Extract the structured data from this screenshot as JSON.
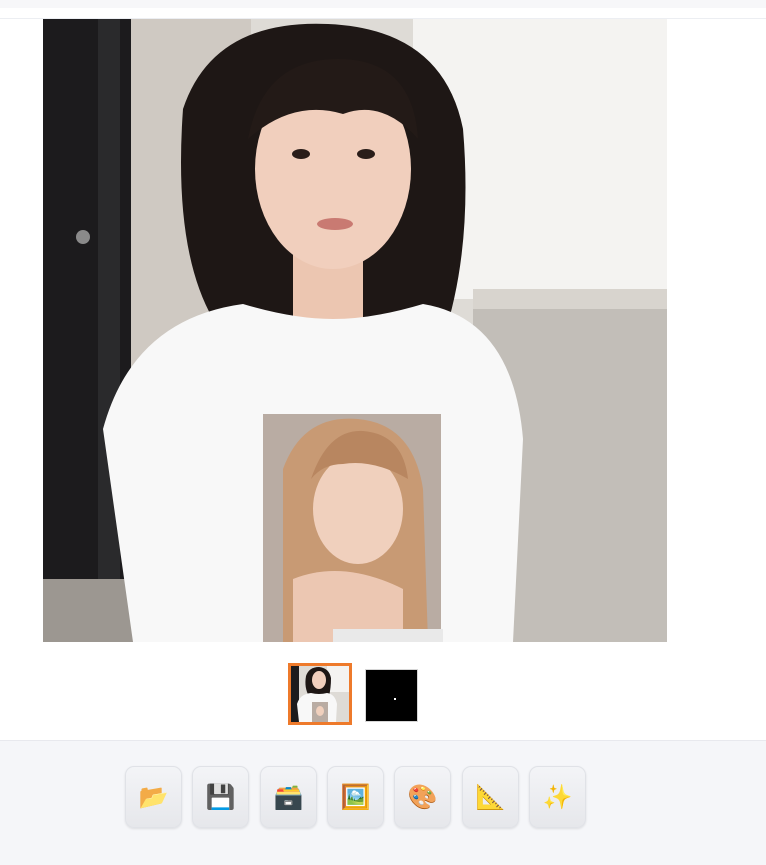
{
  "gallery": {
    "thumbnails": [
      {
        "name": "generated-image-thumb",
        "selected": true
      },
      {
        "name": "mask-image-thumb",
        "selected": false
      }
    ],
    "selected_border_color": "#ee7a2b"
  },
  "toolbar": {
    "buttons": [
      {
        "name": "open-folder-button",
        "icon": "📂"
      },
      {
        "name": "save-button",
        "icon": "💾"
      },
      {
        "name": "zip-archive-button",
        "icon": "🗃️"
      },
      {
        "name": "send-to-img2img-button",
        "icon": "🖼️"
      },
      {
        "name": "send-to-inpaint-button",
        "icon": "🎨"
      },
      {
        "name": "send-to-extras-button",
        "icon": "📐"
      },
      {
        "name": "enhance-button",
        "icon": "✨"
      }
    ]
  }
}
